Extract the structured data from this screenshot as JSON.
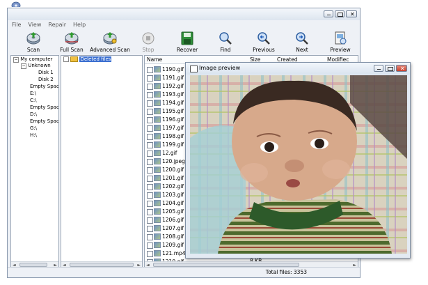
{
  "menu": [
    "File",
    "View",
    "Repair",
    "Help"
  ],
  "toolbar": {
    "scan": "Scan",
    "full_scan": "Full Scan",
    "advanced_scan": "Advanced Scan",
    "stop": "Stop",
    "recover": "Recover",
    "find": "Find",
    "previous": "Previous",
    "next": "Next",
    "preview": "Preview"
  },
  "tree": {
    "root": "My computer",
    "unknown": "Unknown",
    "disk1": "Disk 1",
    "disk2": "Disk 2",
    "empty1": "Empty Space",
    "e": "E:\\",
    "c": "C:\\",
    "empty2": "Empty Space",
    "d": "D:\\",
    "empty3": "Empty Space",
    "g": "G:\\",
    "h": "H:\\"
  },
  "folder": {
    "deleted_files": "Deleted files"
  },
  "columns": {
    "name": "Name",
    "size": "Size",
    "created": "Created",
    "modified": "Modifiec"
  },
  "files": [
    "1190.gif",
    "1191.gif",
    "1192.gif",
    "1193.gif",
    "1194.gif",
    "1195.gif",
    "1196.gif",
    "1197.gif",
    "1198.gif",
    "1199.gif",
    "12.gif",
    "120.jpeg",
    "1200.gif",
    "1201.gif",
    "1202.gif",
    "1203.gif",
    "1204.gif",
    "1205.gif",
    "1206.gif",
    "1207.gif",
    "1208.gif",
    "1209.gif",
    "121.mp4",
    "1210.gif"
  ],
  "last_row_size": "8 KB",
  "status": {
    "total": "Total files: 3353"
  },
  "preview": {
    "title": "Image preview"
  },
  "colors": {
    "accent": "#1e5bb8",
    "window_frame": "#8a99ae",
    "selection": "#3b6fd0"
  }
}
